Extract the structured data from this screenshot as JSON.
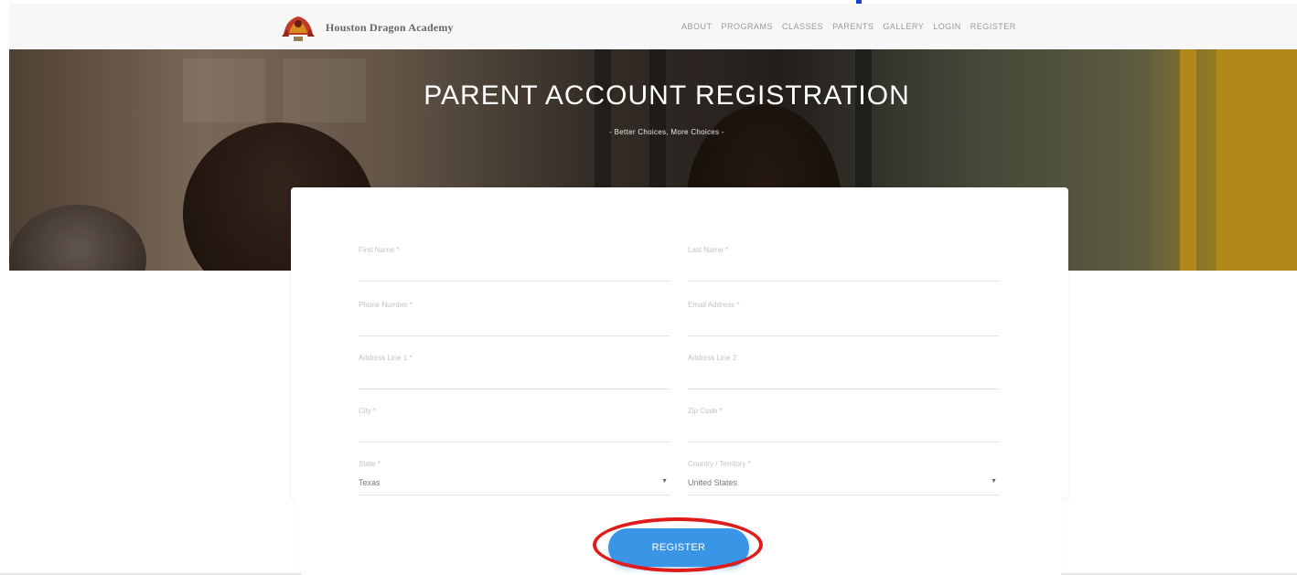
{
  "site": {
    "name": "Houston Dragon Academy"
  },
  "nav": {
    "items": [
      "ABOUT",
      "PROGRAMS",
      "CLASSES",
      "PARENTS",
      "GALLERY",
      "LOGIN",
      "REGISTER"
    ]
  },
  "hero": {
    "title": "PARENT ACCOUNT REGISTRATION",
    "subtitle": "- Better Choices, More Choices -"
  },
  "form": {
    "first_name": {
      "label": "First Name *",
      "value": ""
    },
    "last_name": {
      "label": "Last Name *",
      "value": ""
    },
    "phone": {
      "label": "Phone Number *",
      "value": ""
    },
    "email": {
      "label": "Email Address *",
      "value": ""
    },
    "address1": {
      "label": "Address Line 1 *",
      "value": ""
    },
    "address2": {
      "label": "Address Line 2",
      "value": ""
    },
    "city": {
      "label": "City *",
      "value": ""
    },
    "zip": {
      "label": "Zip Code *",
      "value": ""
    },
    "state": {
      "label": "State *",
      "value": "Texas"
    },
    "country": {
      "label": "Country / Territory *",
      "value": "United States"
    }
  },
  "actions": {
    "register_label": "REGISTER"
  },
  "colors": {
    "accent": "#3b95e6",
    "annotation": "#e01b1b"
  }
}
